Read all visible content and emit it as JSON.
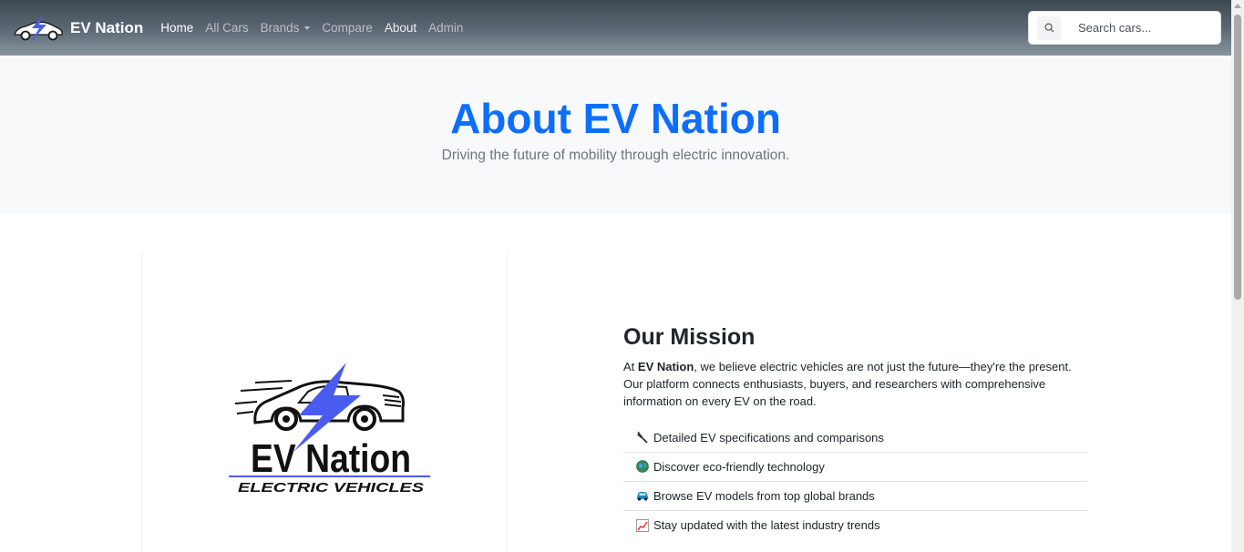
{
  "navbar": {
    "brand": "EV Nation",
    "links": [
      {
        "label": "Home"
      },
      {
        "label": "All Cars"
      },
      {
        "label": "Brands"
      },
      {
        "label": "Compare"
      },
      {
        "label": "About"
      },
      {
        "label": "Admin"
      }
    ],
    "search_placeholder": "Search cars..."
  },
  "hero": {
    "title": "About EV Nation",
    "subtitle": "Driving the future of mobility through electric innovation."
  },
  "logo": {
    "wordmark": "EV Nation",
    "tagline": "ELECTRIC VEHICLES"
  },
  "mission": {
    "title": "Our Mission",
    "text_prefix": "At ",
    "text_bold": "EV Nation",
    "text_rest": ", we believe electric vehicles are not just the future—they're the present. Our platform connects enthusiasts, buyers, and researchers with comprehensive information on every EV on the road.",
    "features": [
      {
        "icon": "plug-icon",
        "label": "Detailed EV specifications and comparisons"
      },
      {
        "icon": "globe-icon",
        "label": "Discover eco-friendly technology"
      },
      {
        "icon": "car-icon",
        "label": "Browse EV models from top global brands"
      },
      {
        "icon": "chart-icon",
        "label": "Stay updated with the latest industry trends"
      }
    ]
  },
  "colors": {
    "accent": "#0d6efd",
    "bolt": "#4a5cf0"
  }
}
